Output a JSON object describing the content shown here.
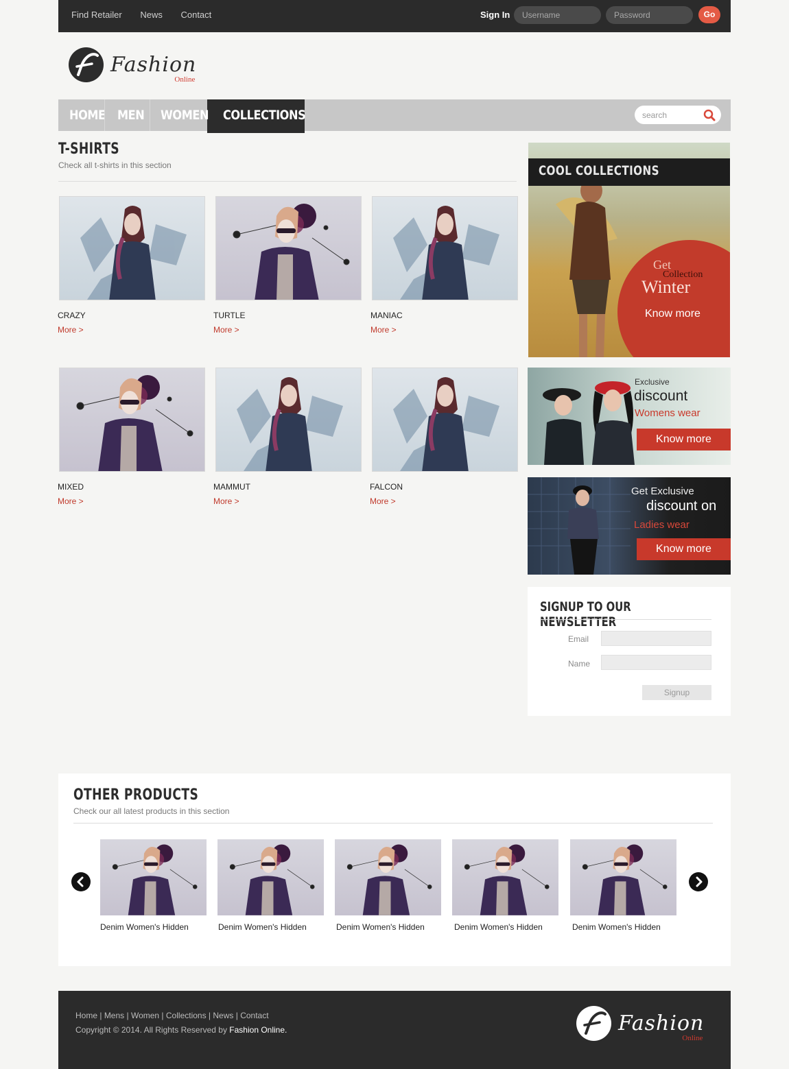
{
  "topbar": {
    "links": [
      "Find Retailer",
      "News",
      "Contact"
    ],
    "signin_label": "Sign In",
    "username_placeholder": "Username",
    "password_placeholder": "Password",
    "go_label": "Go"
  },
  "logo": {
    "text": "Fashion",
    "sub": "Online"
  },
  "nav": {
    "items": [
      "HOME",
      "MEN",
      "WOMEN",
      "COLLECTIONS"
    ],
    "active": "COLLECTIONS",
    "search_placeholder": "search"
  },
  "section": {
    "title": "T-SHIRTS",
    "subtitle": "Check all t-shirts in this section",
    "products": [
      {
        "name": "CRAZY",
        "more": "More >"
      },
      {
        "name": "TURTLE",
        "more": "More >"
      },
      {
        "name": "MANIAC",
        "more": "More >"
      },
      {
        "name": "MIXED",
        "more": "More >"
      },
      {
        "name": "MAMMUT",
        "more": "More >"
      },
      {
        "name": "FALCON",
        "more": "More >"
      }
    ]
  },
  "sidebar": {
    "cool": {
      "title": "COOL COLLECTIONS",
      "get": "Get",
      "collection": "Collection",
      "winter": "Winter",
      "know_more": "Know more"
    },
    "discount1": {
      "exclusive": "Exclusive",
      "discount": "discount",
      "category": "Womens wear",
      "know_more": "Know more"
    },
    "discount2": {
      "get_exclusive": "Get Exclusive",
      "discount_on": "discount on",
      "category": "Ladies wear",
      "know_more": "Know more"
    },
    "newsletter": {
      "title": "SIGNUP TO OUR NEWSLETTER",
      "email_label": "Email",
      "name_label": "Name",
      "signup_label": "Signup"
    }
  },
  "other": {
    "title": "OTHER PRODUCTS",
    "subtitle": "Check our all latest products in this section",
    "items": [
      "Denim Women's Hidden",
      "Denim Women's Hidden",
      "Denim Women's Hidden",
      "Denim Women's Hidden",
      "Denim Women's Hidden"
    ]
  },
  "footer": {
    "links": [
      "Home",
      "Mens",
      "Women",
      "Collections",
      "News",
      "Contact"
    ],
    "copyright": "Copyright © 2014. All Rights Reserved by",
    "brand": "Fashion Online."
  },
  "colors": {
    "accent": "#c8392b",
    "dark": "#2b2b2b",
    "nav": "#c7c7c7"
  }
}
